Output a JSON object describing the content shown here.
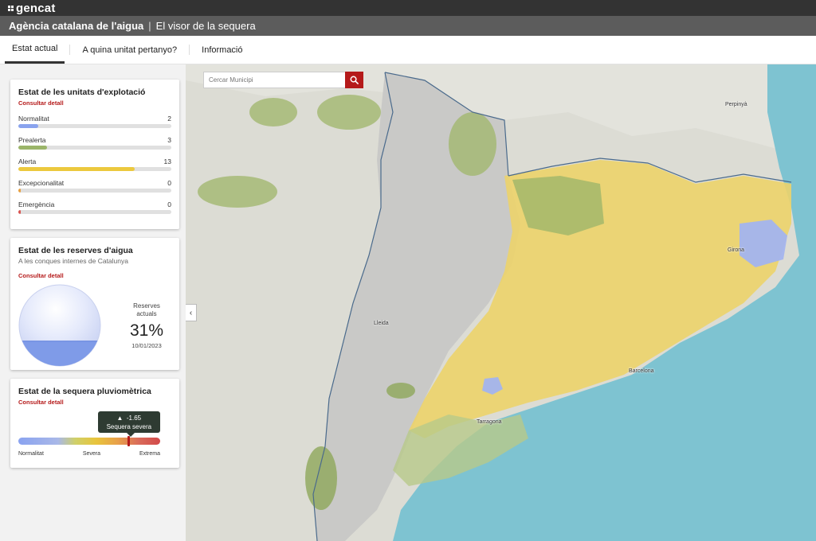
{
  "header": {
    "brand": "gencat",
    "agency": "Agència catalana de l'aigua",
    "separator": "|",
    "app_name": "El visor de la sequera"
  },
  "tabs": [
    {
      "label": "Estat actual",
      "active": true
    },
    {
      "label": "A quina unitat pertanyo?",
      "active": false
    },
    {
      "label": "Informació",
      "active": false
    }
  ],
  "units_card": {
    "title": "Estat de les unitats d'explotació",
    "link": "Consultar detall",
    "items": [
      {
        "label": "Normalitat",
        "count": "2",
        "color": "#8aa3ee",
        "fill": 0.13
      },
      {
        "label": "Prealerta",
        "count": "3",
        "color": "#9bb56a",
        "fill": 0.19
      },
      {
        "label": "Alerta",
        "count": "13",
        "color": "#ecc93e",
        "fill": 0.76
      },
      {
        "label": "Excepcionalitat",
        "count": "0",
        "color": "#e8a040",
        "fill": 0.0
      },
      {
        "label": "Emergència",
        "count": "0",
        "color": "#d9534f",
        "fill": 0.0
      }
    ]
  },
  "reserves_card": {
    "title": "Estat de les reserves d'aigua",
    "subtitle": "A les conques internes de Catalunya",
    "link": "Consultar detall",
    "label_line1": "Reserves",
    "label_line2": "actuals",
    "percent": "31%",
    "fill_fraction": 0.31,
    "date": "10/01/2023"
  },
  "drought_card": {
    "title": "Estat de la sequera pluviomètrica",
    "link": "Consultar detall",
    "value": "-1.65",
    "status": "Sequera severa",
    "marker_fraction": 0.78,
    "scale": [
      "Normalitat",
      "Severa",
      "Extrema"
    ]
  },
  "map": {
    "search_placeholder": "Cercar Municipi",
    "collapse_icon": "‹",
    "places": [
      "Perpinyà",
      "Lleida",
      "Barcelona",
      "Tarragona",
      "Girona"
    ]
  },
  "colors": {
    "brand_red": "#b51a1a",
    "sea": "#7ec3d1",
    "alerta_yellow": "#ecd36a",
    "prealerta_green": "#9fb56a",
    "normalitat_blue": "#a3b4ee"
  }
}
